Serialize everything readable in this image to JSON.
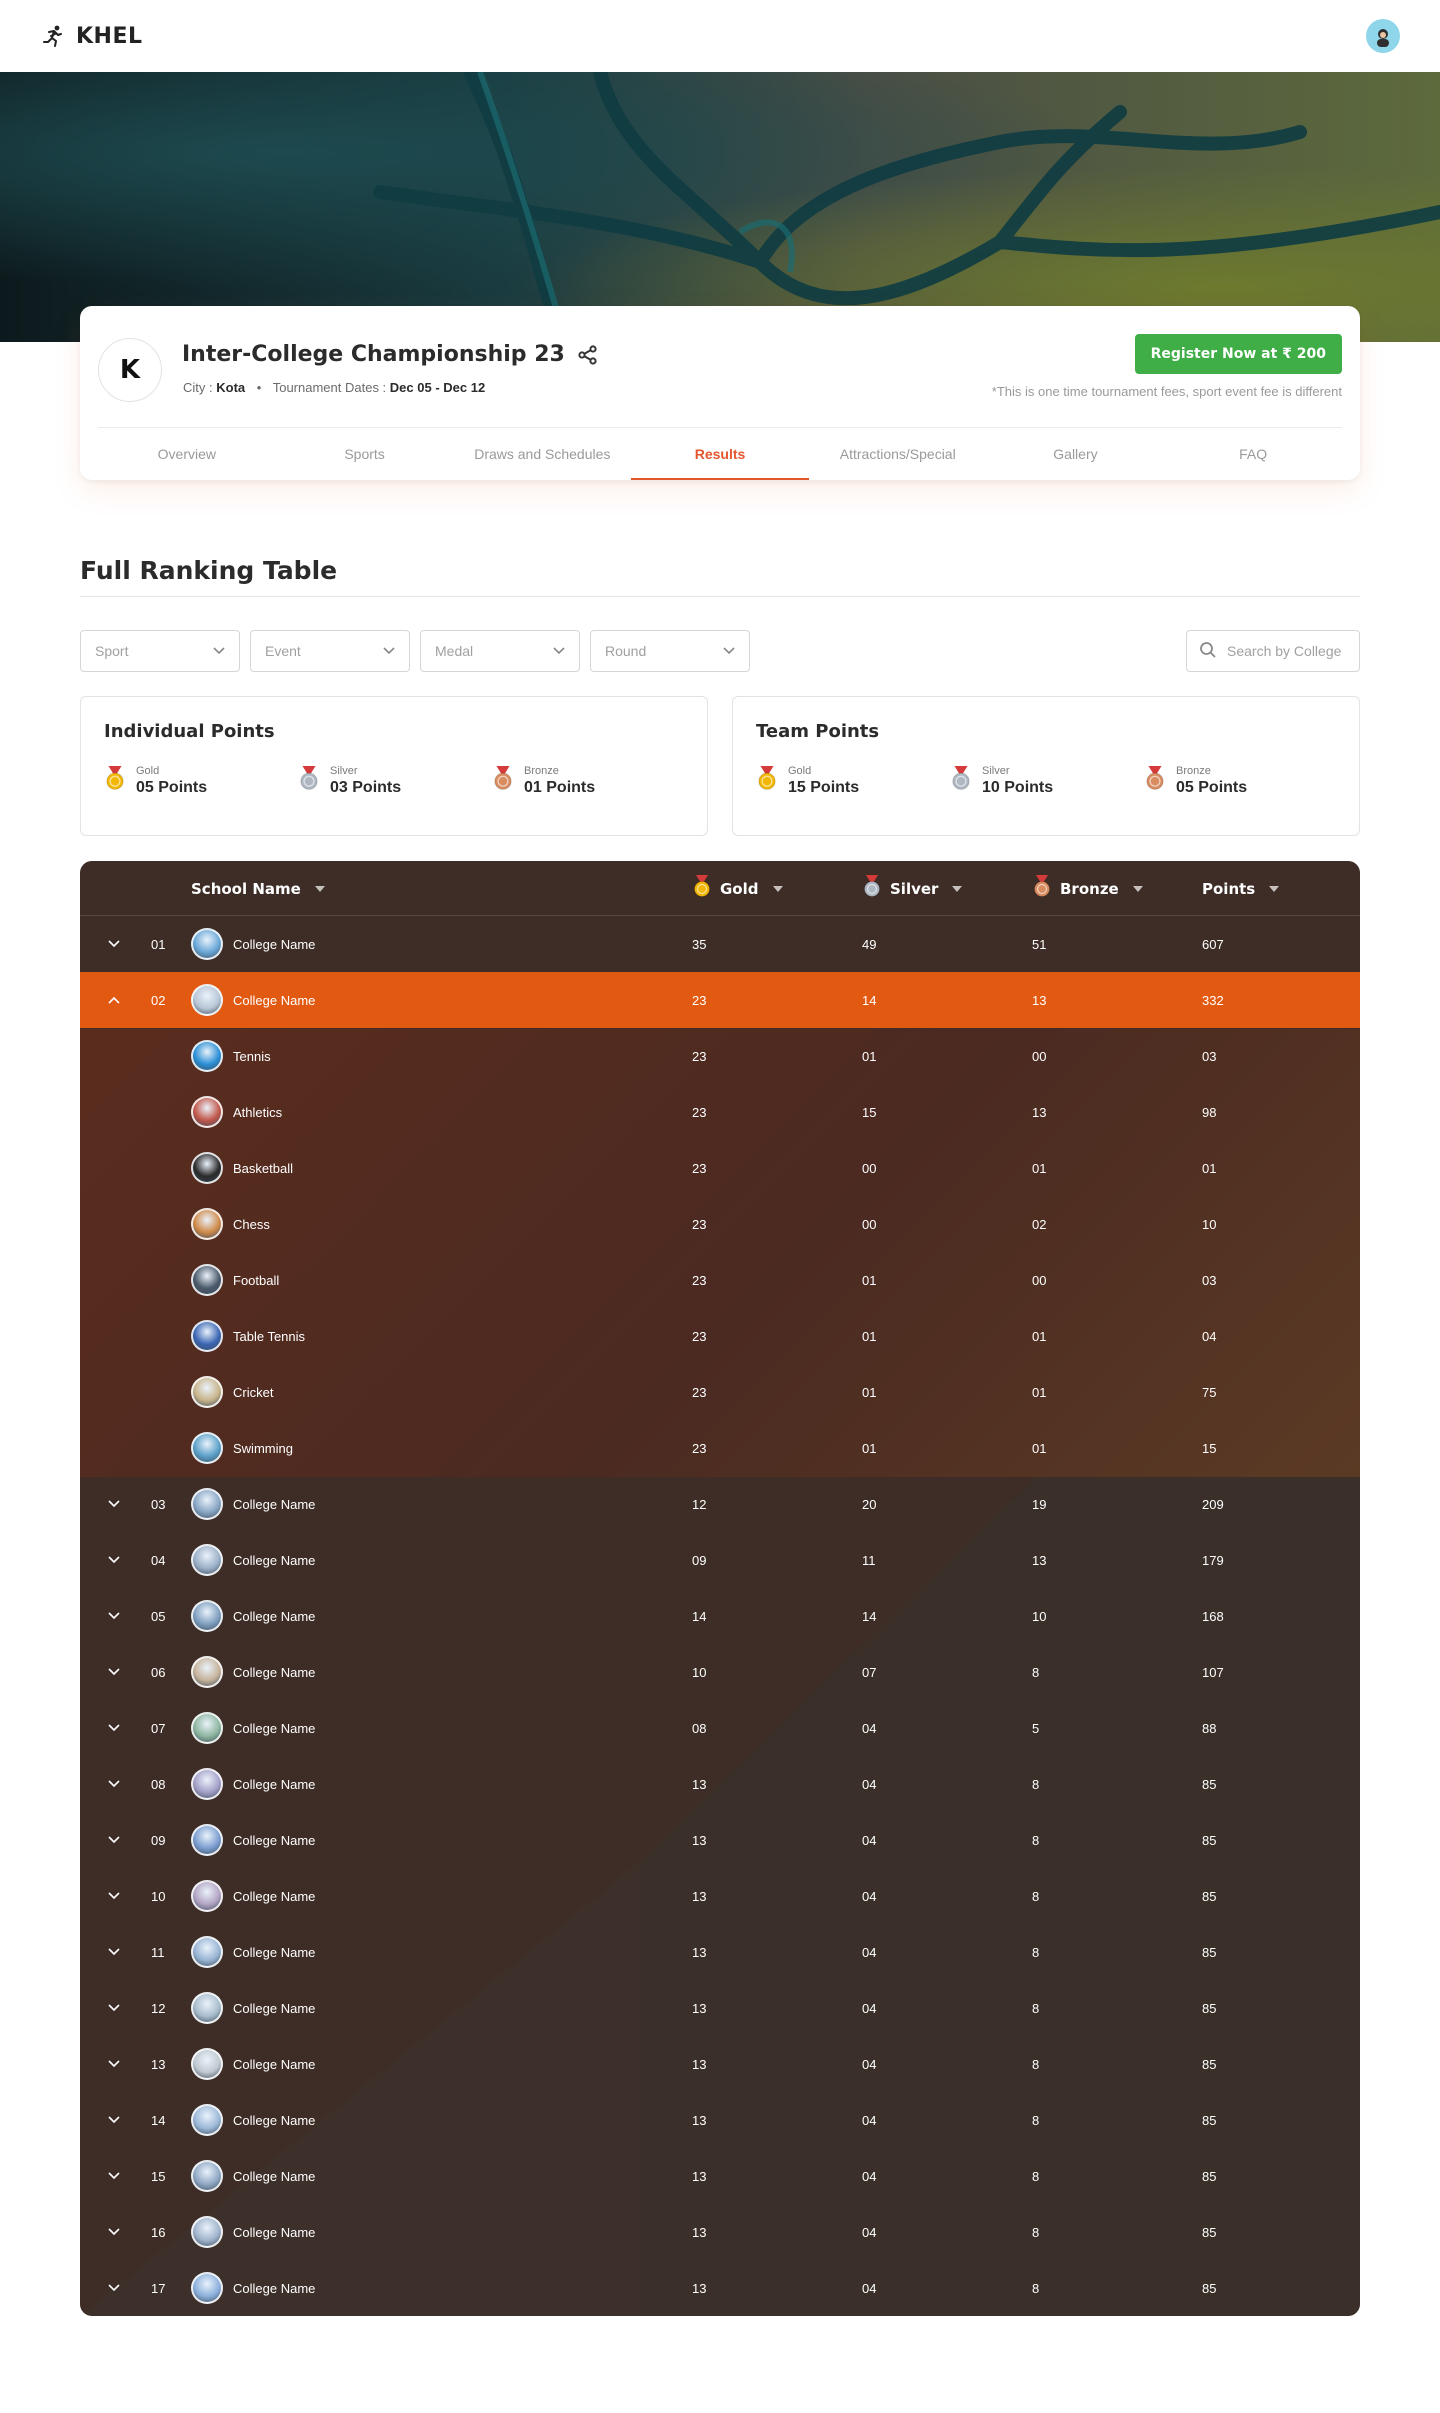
{
  "header": {
    "brand": "KHEL"
  },
  "event": {
    "title": "Inter-College Championship 23",
    "city_label": "City :",
    "city": "Kota",
    "dates_label": "Tournament Dates :",
    "dates": "Dec 05 - Dec 12",
    "register_label": "Register Now at ₹ 200",
    "fee_note": "*This is one time tournament fees, sport event fee is different",
    "logo_letter": "K"
  },
  "tabs": [
    {
      "label": "Overview"
    },
    {
      "label": "Sports"
    },
    {
      "label": "Draws and Schedules"
    },
    {
      "label": "Results",
      "active": true
    },
    {
      "label": "Attractions/Special"
    },
    {
      "label": "Gallery"
    },
    {
      "label": "FAQ"
    }
  ],
  "section": {
    "title": "Full Ranking Table"
  },
  "filters": [
    "Sport",
    "Event",
    "Medal",
    "Round"
  ],
  "search": {
    "placeholder": "Search by College"
  },
  "individual_points": {
    "title": "Individual Points",
    "medals": [
      {
        "label": "Gold",
        "value": "05 Points"
      },
      {
        "label": "Silver",
        "value": "03 Points"
      },
      {
        "label": "Bronze",
        "value": "01 Points"
      }
    ]
  },
  "team_points": {
    "title": "Team Points",
    "medals": [
      {
        "label": "Gold",
        "value": "15 Points"
      },
      {
        "label": "Silver",
        "value": "10 Points"
      },
      {
        "label": "Bronze",
        "value": "05 Points"
      }
    ]
  },
  "table": {
    "columns": {
      "school": "School Name",
      "gold": "Gold",
      "silver": "Silver",
      "bronze": "Bronze",
      "points": "Points"
    },
    "colors": {
      "gold": "#f2b705",
      "silver": "#aeb7c2",
      "bronze": "#d98c5f",
      "selected": "#e25a12"
    },
    "rows": [
      {
        "rank": "01",
        "name": "College Name",
        "gold": "35",
        "silver": "49",
        "bronze": "51",
        "points": "607"
      },
      {
        "rank": "02",
        "name": "College Name",
        "gold": "23",
        "silver": "14",
        "bronze": "13",
        "points": "332",
        "expanded": true,
        "sports": [
          {
            "name": "Tennis",
            "gold": "23",
            "silver": "01",
            "bronze": "00",
            "points": "03"
          },
          {
            "name": "Athletics",
            "gold": "23",
            "silver": "15",
            "bronze": "13",
            "points": "98"
          },
          {
            "name": "Basketball",
            "gold": "23",
            "silver": "00",
            "bronze": "01",
            "points": "01"
          },
          {
            "name": "Chess",
            "gold": "23",
            "silver": "00",
            "bronze": "02",
            "points": "10"
          },
          {
            "name": "Football",
            "gold": "23",
            "silver": "01",
            "bronze": "00",
            "points": "03"
          },
          {
            "name": "Table Tennis",
            "gold": "23",
            "silver": "01",
            "bronze": "01",
            "points": "04"
          },
          {
            "name": "Cricket",
            "gold": "23",
            "silver": "01",
            "bronze": "01",
            "points": "75"
          },
          {
            "name": "Swimming",
            "gold": "23",
            "silver": "01",
            "bronze": "01",
            "points": "15"
          }
        ]
      },
      {
        "rank": "03",
        "name": "College Name",
        "gold": "12",
        "silver": "20",
        "bronze": "19",
        "points": "209"
      },
      {
        "rank": "04",
        "name": "College Name",
        "gold": "09",
        "silver": "11",
        "bronze": "13",
        "points": "179"
      },
      {
        "rank": "05",
        "name": "College Name",
        "gold": "14",
        "silver": "14",
        "bronze": "10",
        "points": "168"
      },
      {
        "rank": "06",
        "name": "College Name",
        "gold": "10",
        "silver": "07",
        "bronze": "8",
        "points": "107"
      },
      {
        "rank": "07",
        "name": "College Name",
        "gold": "08",
        "silver": "04",
        "bronze": "5",
        "points": "88"
      },
      {
        "rank": "08",
        "name": "College Name",
        "gold": "13",
        "silver": "04",
        "bronze": "8",
        "points": "85"
      },
      {
        "rank": "09",
        "name": "College Name",
        "gold": "13",
        "silver": "04",
        "bronze": "8",
        "points": "85"
      },
      {
        "rank": "10",
        "name": "College Name",
        "gold": "13",
        "silver": "04",
        "bronze": "8",
        "points": "85"
      },
      {
        "rank": "11",
        "name": "College Name",
        "gold": "13",
        "silver": "04",
        "bronze": "8",
        "points": "85"
      },
      {
        "rank": "12",
        "name": "College Name",
        "gold": "13",
        "silver": "04",
        "bronze": "8",
        "points": "85"
      },
      {
        "rank": "13",
        "name": "College Name",
        "gold": "13",
        "silver": "04",
        "bronze": "8",
        "points": "85"
      },
      {
        "rank": "14",
        "name": "College Name",
        "gold": "13",
        "silver": "04",
        "bronze": "8",
        "points": "85"
      },
      {
        "rank": "15",
        "name": "College Name",
        "gold": "13",
        "silver": "04",
        "bronze": "8",
        "points": "85"
      },
      {
        "rank": "16",
        "name": "College Name",
        "gold": "13",
        "silver": "04",
        "bronze": "8",
        "points": "85"
      },
      {
        "rank": "17",
        "name": "College Name",
        "gold": "13",
        "silver": "04",
        "bronze": "8",
        "points": "85"
      }
    ]
  }
}
